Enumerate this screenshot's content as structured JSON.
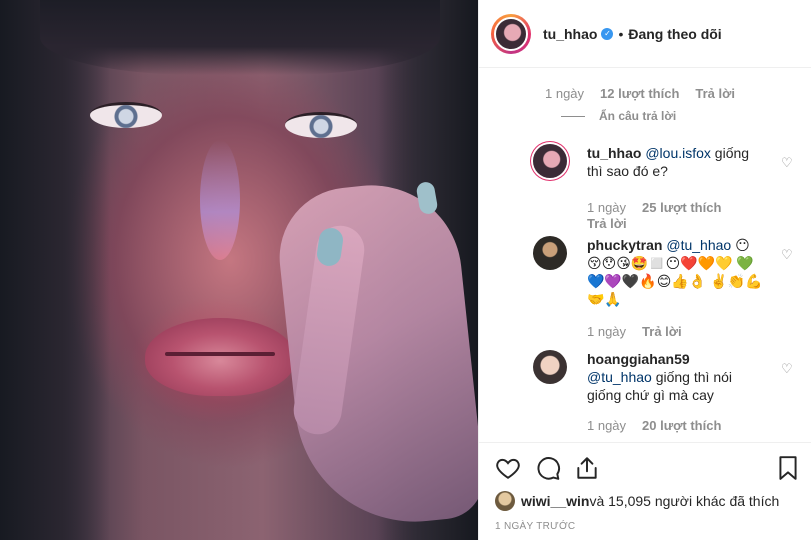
{
  "post": {
    "image_alt": "close-up portrait photo"
  },
  "header": {
    "username": "tu_hhao",
    "separator": "•",
    "follow_status": "Đang theo dõi"
  },
  "comments": {
    "top_meta": {
      "age": "1 ngày",
      "likes": "12 lượt thích",
      "reply": "Trả lời"
    },
    "hide_replies": "Ẩn câu trả lời",
    "replies": [
      {
        "author": "tu_hhao",
        "mention": "@lou.isfox",
        "text": " giống thì sao đó e?",
        "age": "1 ngày",
        "likes": "25 lượt thích",
        "reply": "Trả lời"
      },
      {
        "author": "phuckytran",
        "mention": "@tu_hhao",
        "text": "😶 😚😯😘🤩◻️😶❤️🧡💛 💚💙💜🖤🔥😊👍👌 ✌️👏💪🤝🙏",
        "age": "1 ngày",
        "reply": "Trả lời"
      },
      {
        "author": "hoanggiahan59",
        "mention": "@tu_hhao",
        "text": " giống thì nói giống chứ gì mà cay",
        "age": "1 ngày",
        "likes": "20 lượt thích"
      }
    ]
  },
  "actions": {
    "liked_by": "wiwi__win",
    "liked_rest": " và 15,095 người khác đã thích",
    "timestamp": "1 NGÀY TRƯỚC"
  },
  "colors": {
    "verified": "#3897f0",
    "mention": "#003569",
    "muted": "#8e8e8e",
    "text": "#262626"
  }
}
